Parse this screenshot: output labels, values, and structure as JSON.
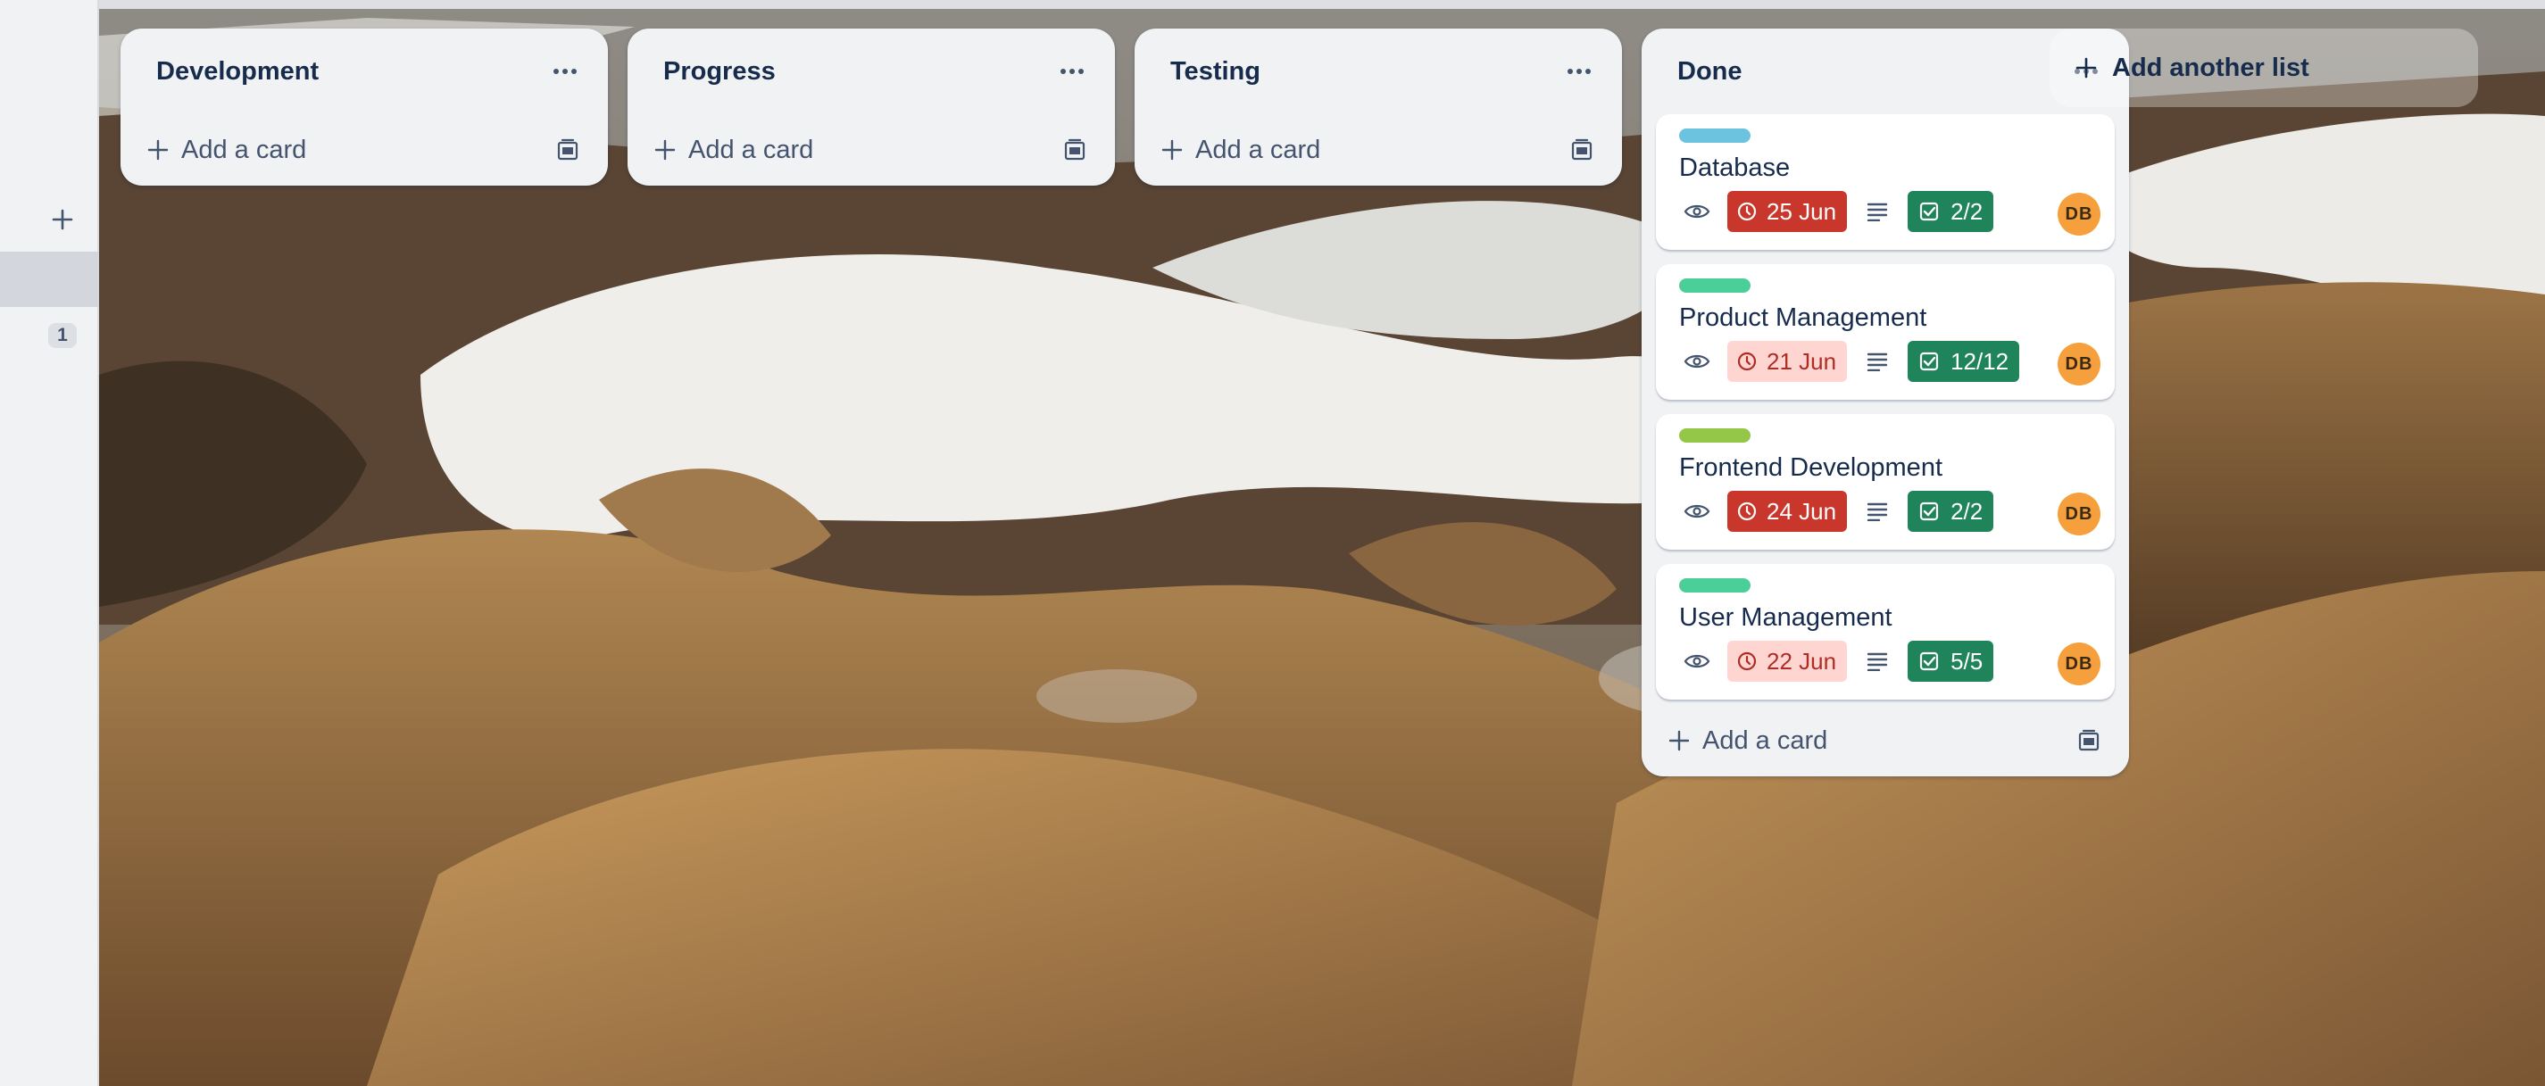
{
  "sidebar": {
    "add_icon": "plus-icon",
    "badge_count": "1"
  },
  "lists": [
    {
      "title": "Development",
      "add_card_label": "Add a card"
    },
    {
      "title": "Progress",
      "add_card_label": "Add a card"
    },
    {
      "title": "Testing",
      "add_card_label": "Add a card"
    },
    {
      "title": "Done",
      "add_card_label": "Add a card",
      "cards": [
        {
          "label_color": "#6cc3e0",
          "title": "Database",
          "due": "25 Jun",
          "due_state": "overdue",
          "checklist": "2/2",
          "avatar": "DB"
        },
        {
          "label_color": "#4bce97",
          "title": "Product Management",
          "due": "21 Jun",
          "due_state": "soon",
          "checklist": "12/12",
          "avatar": "DB"
        },
        {
          "label_color": "#94c748",
          "title": "Frontend Development",
          "due": "24 Jun",
          "due_state": "overdue",
          "checklist": "2/2",
          "avatar": "DB"
        },
        {
          "label_color": "#4bce97",
          "title": "User Management",
          "due": "22 Jun",
          "due_state": "soon",
          "checklist": "5/5",
          "avatar": "DB"
        }
      ]
    }
  ],
  "add_list_label": "Add another list",
  "colors": {
    "overdue": "#c9372c",
    "due_soon_bg": "#ffd5d2",
    "checklist_complete": "#1f845a",
    "avatar": "#f5a03c",
    "list_bg": "#f1f2f4"
  }
}
